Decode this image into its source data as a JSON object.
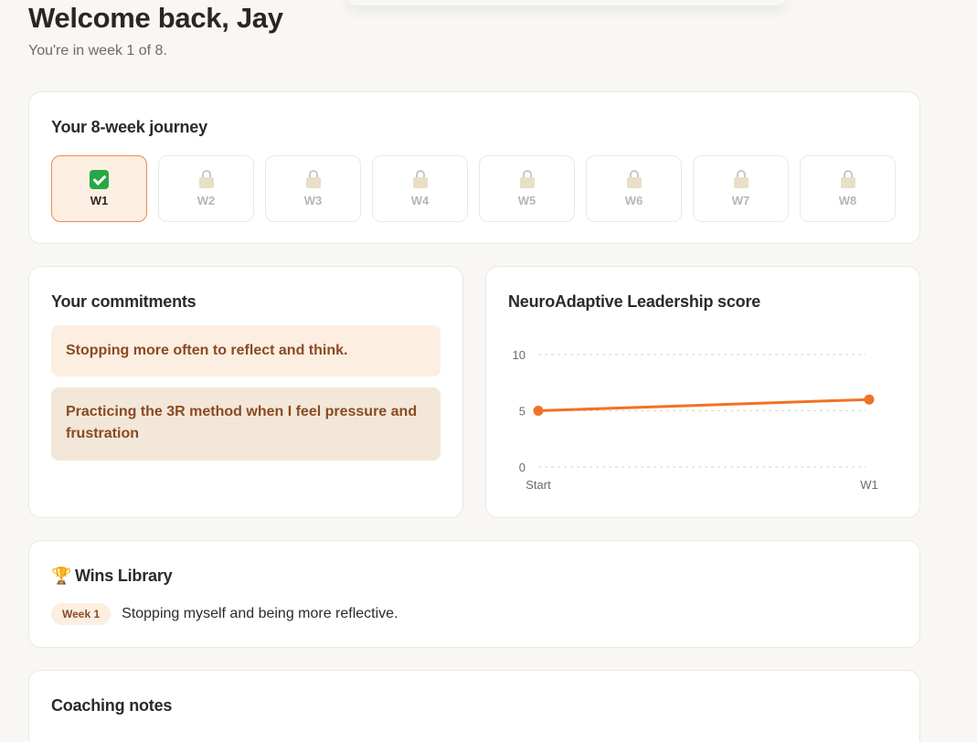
{
  "header": {
    "title": "Welcome back, Jay",
    "subtitle": "You're in week 1 of 8."
  },
  "journey": {
    "title": "Your 8-week journey",
    "weeks": [
      {
        "label": "W1",
        "status": "complete",
        "icon": "check-icon"
      },
      {
        "label": "W2",
        "status": "locked",
        "icon": "lock-icon"
      },
      {
        "label": "W3",
        "status": "locked",
        "icon": "lock-icon"
      },
      {
        "label": "W4",
        "status": "locked",
        "icon": "lock-icon"
      },
      {
        "label": "W5",
        "status": "locked",
        "icon": "lock-icon"
      },
      {
        "label": "W6",
        "status": "locked",
        "icon": "lock-icon"
      },
      {
        "label": "W7",
        "status": "locked",
        "icon": "lock-icon"
      },
      {
        "label": "W8",
        "status": "locked",
        "icon": "lock-icon"
      }
    ]
  },
  "commitments": {
    "title": "Your commitments",
    "items": [
      "Stopping more often to reflect and think.",
      "Practicing the 3R method when I feel pressure and frustration"
    ]
  },
  "score": {
    "title": "NeuroAdaptive Leadership score"
  },
  "chart_data": {
    "type": "line",
    "title": "NeuroAdaptive Leadership score",
    "categories": [
      "Start",
      "W1"
    ],
    "series": [
      {
        "values": [
          5,
          6
        ]
      }
    ],
    "ylim": [
      0,
      10
    ],
    "yticks": [
      "10",
      "5",
      "0"
    ],
    "grid": true,
    "line_color": "#f07226"
  },
  "wins": {
    "title": "Wins Library",
    "icon": "trophy-icon",
    "items": [
      {
        "badge": "Week 1",
        "text": "Stopping myself and being more reflective."
      }
    ]
  },
  "coaching": {
    "title": "Coaching notes"
  },
  "colors": {
    "accent": "#f07226",
    "active_week_bg": "#fdeee2",
    "active_week_border": "#ee8a50",
    "commit_text": "#8a4a22"
  }
}
